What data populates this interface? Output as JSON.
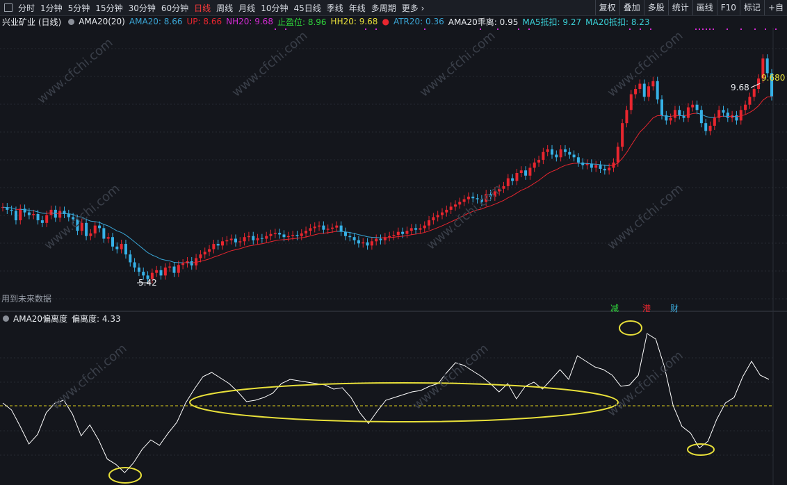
{
  "toolbar": {
    "items": [
      {
        "label": "分时",
        "active": false
      },
      {
        "label": "1分钟",
        "active": false
      },
      {
        "label": "5分钟",
        "active": false
      },
      {
        "label": "15分钟",
        "active": false
      },
      {
        "label": "30分钟",
        "active": false
      },
      {
        "label": "60分钟",
        "active": false
      },
      {
        "label": "日线",
        "active": true
      },
      {
        "label": "周线",
        "active": false
      },
      {
        "label": "月线",
        "active": false
      },
      {
        "label": "10分钟",
        "active": false
      },
      {
        "label": "45日线",
        "active": false
      },
      {
        "label": "季线",
        "active": false
      },
      {
        "label": "年线",
        "active": false
      },
      {
        "label": "多周期",
        "active": false
      },
      {
        "label": "更多 ›",
        "active": false
      }
    ],
    "right": [
      "复权",
      "叠加",
      "多股",
      "统计",
      "画线",
      "F10",
      "标记",
      "+自"
    ]
  },
  "info_main": {
    "stock": "兴业矿业 (日线)",
    "indicator": "AMA20(20)",
    "ama20": "AMA20: 8.66",
    "up": "UP: 8.66",
    "nh20": "NH20: 9.68",
    "stop": "止盈位: 8.96",
    "hh20": "HH20: 9.68",
    "atr20": "ATR20: 0.36",
    "dev": "AMA20乖离: 0.95",
    "ma5": "MA5抵扣: 9.27",
    "ma20": "MA20抵扣: 8.23"
  },
  "info_sub": {
    "title": "AMA20偏离度",
    "value": "偏离度: 4.33"
  },
  "annotations": {
    "high": "9.680",
    "high_marker": "9.68",
    "low": "5.42",
    "future_note": "用到未来数据",
    "sig1": "减",
    "sig2": "港",
    "sig3": "财",
    "watermark": "www.cfchi.com"
  },
  "colors": {
    "up": "#e8262f",
    "down": "#36b1e6",
    "ama_up": "#e8262f",
    "ama_down": "#3aa6d6",
    "deviation": "#ffffff",
    "zero": "#e0d21c",
    "ellipse": "#e8e03a"
  },
  "chart_data": [
    {
      "type": "candlestick",
      "title": "兴业矿业 (日线)",
      "ylim": [
        5.0,
        10.0
      ],
      "closes": [
        6.85,
        6.8,
        6.78,
        6.6,
        6.82,
        6.75,
        6.7,
        6.72,
        6.6,
        6.55,
        6.7,
        6.8,
        6.65,
        6.78,
        6.72,
        6.66,
        6.62,
        6.4,
        6.55,
        6.3,
        6.35,
        6.5,
        6.45,
        6.25,
        6.28,
        6.1,
        6.05,
        6.15,
        5.95,
        5.8,
        5.7,
        5.62,
        5.55,
        5.48,
        5.6,
        5.65,
        5.55,
        5.7,
        5.72,
        5.6,
        5.75,
        5.78,
        5.82,
        5.74,
        5.88,
        5.95,
        6.0,
        6.05,
        6.15,
        6.12,
        6.2,
        6.22,
        6.25,
        6.18,
        6.2,
        6.28,
        6.3,
        6.22,
        6.26,
        6.25,
        6.3,
        6.34,
        6.36,
        6.33,
        6.28,
        6.3,
        6.32,
        6.3,
        6.35,
        6.4,
        6.45,
        6.48,
        6.5,
        6.42,
        6.44,
        6.46,
        6.5,
        6.38,
        6.3,
        6.28,
        6.22,
        6.16,
        6.18,
        6.12,
        6.2,
        6.25,
        6.22,
        6.28,
        6.3,
        6.32,
        6.38,
        6.34,
        6.4,
        6.45,
        6.42,
        6.45,
        6.5,
        6.6,
        6.66,
        6.7,
        6.75,
        6.8,
        6.86,
        6.9,
        6.95,
        7.0,
        7.05,
        7.02,
        7.0,
        6.95,
        7.1,
        7.05,
        7.15,
        7.2,
        7.25,
        7.4,
        7.35,
        7.5,
        7.55,
        7.45,
        7.6,
        7.7,
        7.75,
        7.9,
        7.95,
        7.85,
        7.8,
        7.95,
        7.9,
        7.85,
        7.8,
        7.7,
        7.65,
        7.68,
        7.6,
        7.65,
        7.58,
        7.55,
        7.6,
        7.7,
        8.0,
        8.45,
        8.7,
        9.0,
        9.1,
        9.2,
        8.95,
        9.15,
        9.25,
        8.9,
        8.6,
        8.5,
        8.55,
        8.7,
        8.6,
        8.55,
        8.75,
        8.8,
        8.7,
        8.45,
        8.3,
        8.4,
        8.55,
        8.7,
        8.65,
        8.55,
        8.6,
        8.5,
        8.7,
        8.8,
        8.95,
        9.1,
        9.3,
        9.68,
        9.4,
        8.96
      ],
      "low_marker": {
        "value": 5.42
      },
      "high_marker": {
        "value": 9.68
      }
    },
    {
      "type": "line",
      "title": "AMA20偏离度",
      "series": [
        {
          "name": "偏离度",
          "values": [
            0.2,
            -0.3,
            -1.5,
            -2.8,
            -2.1,
            -0.5,
            0.2,
            0.4,
            -0.6,
            -2.2,
            -1.4,
            -2.5,
            -3.9,
            -4.3,
            -4.9,
            -4.2,
            -3.2,
            -2.5,
            -2.9,
            -2.0,
            -1.2,
            0.2,
            1.2,
            2.1,
            2.4,
            2.0,
            1.6,
            1.0,
            0.3,
            0.4,
            0.6,
            0.9,
            1.6,
            1.9,
            1.8,
            1.7,
            1.6,
            1.5,
            1.2,
            1.3,
            0.6,
            -0.5,
            -1.3,
            -0.4,
            0.4,
            0.6,
            0.8,
            1.0,
            1.1,
            1.4,
            1.6,
            2.4,
            3.1,
            2.9,
            2.5,
            2.1,
            1.6,
            1.0,
            1.6,
            0.5,
            1.4,
            1.7,
            1.2,
            1.9,
            2.6,
            1.9,
            3.6,
            3.2,
            2.8,
            2.6,
            2.2,
            1.4,
            1.5,
            2.2,
            5.2,
            4.8,
            2.8,
            0.0,
            -1.5,
            -2.0,
            -3.1,
            -2.6,
            -1.0,
            0.2,
            0.6,
            2.1,
            3.2,
            2.2,
            1.9
          ]
        }
      ],
      "zero_line": 0
    }
  ]
}
